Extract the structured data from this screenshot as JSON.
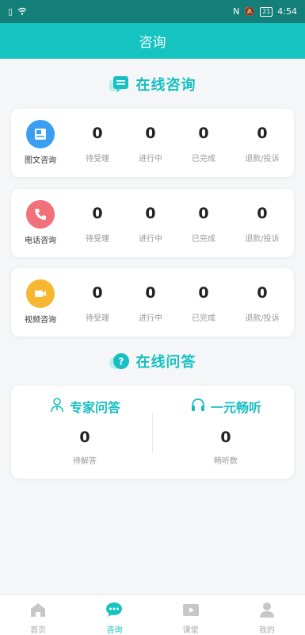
{
  "status_bar": {
    "time": "4:54",
    "battery": "21"
  },
  "header": {
    "title": "咨询"
  },
  "online_consult": {
    "title": "在线咨询",
    "cards": [
      {
        "label": "图文咨询",
        "icon": "image-doc-icon",
        "color": "#3a9ff0",
        "stats": [
          {
            "value": "0",
            "label": "待受理"
          },
          {
            "value": "0",
            "label": "进行中"
          },
          {
            "value": "0",
            "label": "已完成"
          },
          {
            "value": "0",
            "label": "退款/投诉"
          }
        ]
      },
      {
        "label": "电话咨询",
        "icon": "phone-icon",
        "color": "#f2707a",
        "stats": [
          {
            "value": "0",
            "label": "待受理"
          },
          {
            "value": "0",
            "label": "进行中"
          },
          {
            "value": "0",
            "label": "已完成"
          },
          {
            "value": "0",
            "label": "退款/投诉"
          }
        ]
      },
      {
        "label": "视频咨询",
        "icon": "video-icon",
        "color": "#f7b731",
        "stats": [
          {
            "value": "0",
            "label": "待受理"
          },
          {
            "value": "0",
            "label": "进行中"
          },
          {
            "value": "0",
            "label": "已完成"
          },
          {
            "value": "0",
            "label": "退款/投诉"
          }
        ]
      }
    ]
  },
  "online_qa": {
    "title": "在线问答",
    "expert": {
      "title": "专家问答",
      "value": "0",
      "label": "待解答"
    },
    "listen": {
      "title": "一元畅听",
      "value": "0",
      "label": "畅听数"
    }
  },
  "tabbar": [
    {
      "label": "首页",
      "icon": "home-icon"
    },
    {
      "label": "咨询",
      "icon": "chat-icon",
      "active": true
    },
    {
      "label": "课堂",
      "icon": "video-play-icon"
    },
    {
      "label": "我的",
      "icon": "user-icon"
    }
  ],
  "colors": {
    "accent": "#15c4c1",
    "status_bar": "#137f78"
  }
}
